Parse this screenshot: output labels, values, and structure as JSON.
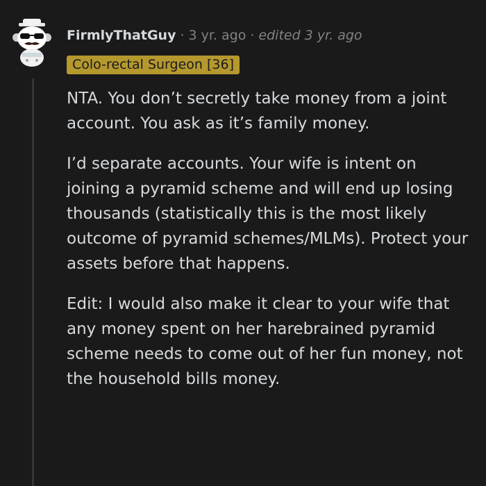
{
  "comment": {
    "username": "FirmlyThatGuy",
    "separator": "·",
    "timestamp": "3 yr. ago",
    "edited": "edited 3 yr. ago",
    "flair": "Colo-rectal Surgeon [36]",
    "paragraphs": [
      "NTA. You don’t secretly take money from a joint account. You ask as it’s family money.",
      "I’d separate accounts. Your wife is intent on joining a pyramid scheme and will end up losing thousands (statistically this is the most likely outcome of pyramid schemes/MLMs). Protect your assets before that happens.",
      "Edit: I would also make it clear to your wife that any money spent on her harebrained pyramid scheme needs to come out of her fun money, not the household bills money."
    ]
  },
  "colors": {
    "background": "#1a1a1b",
    "text": "#d7dadc",
    "meta": "#818384",
    "flair_bg": "#b5982e",
    "thread_line": "#343536"
  },
  "icons": {
    "avatar": "snoo-avatar-icon"
  }
}
